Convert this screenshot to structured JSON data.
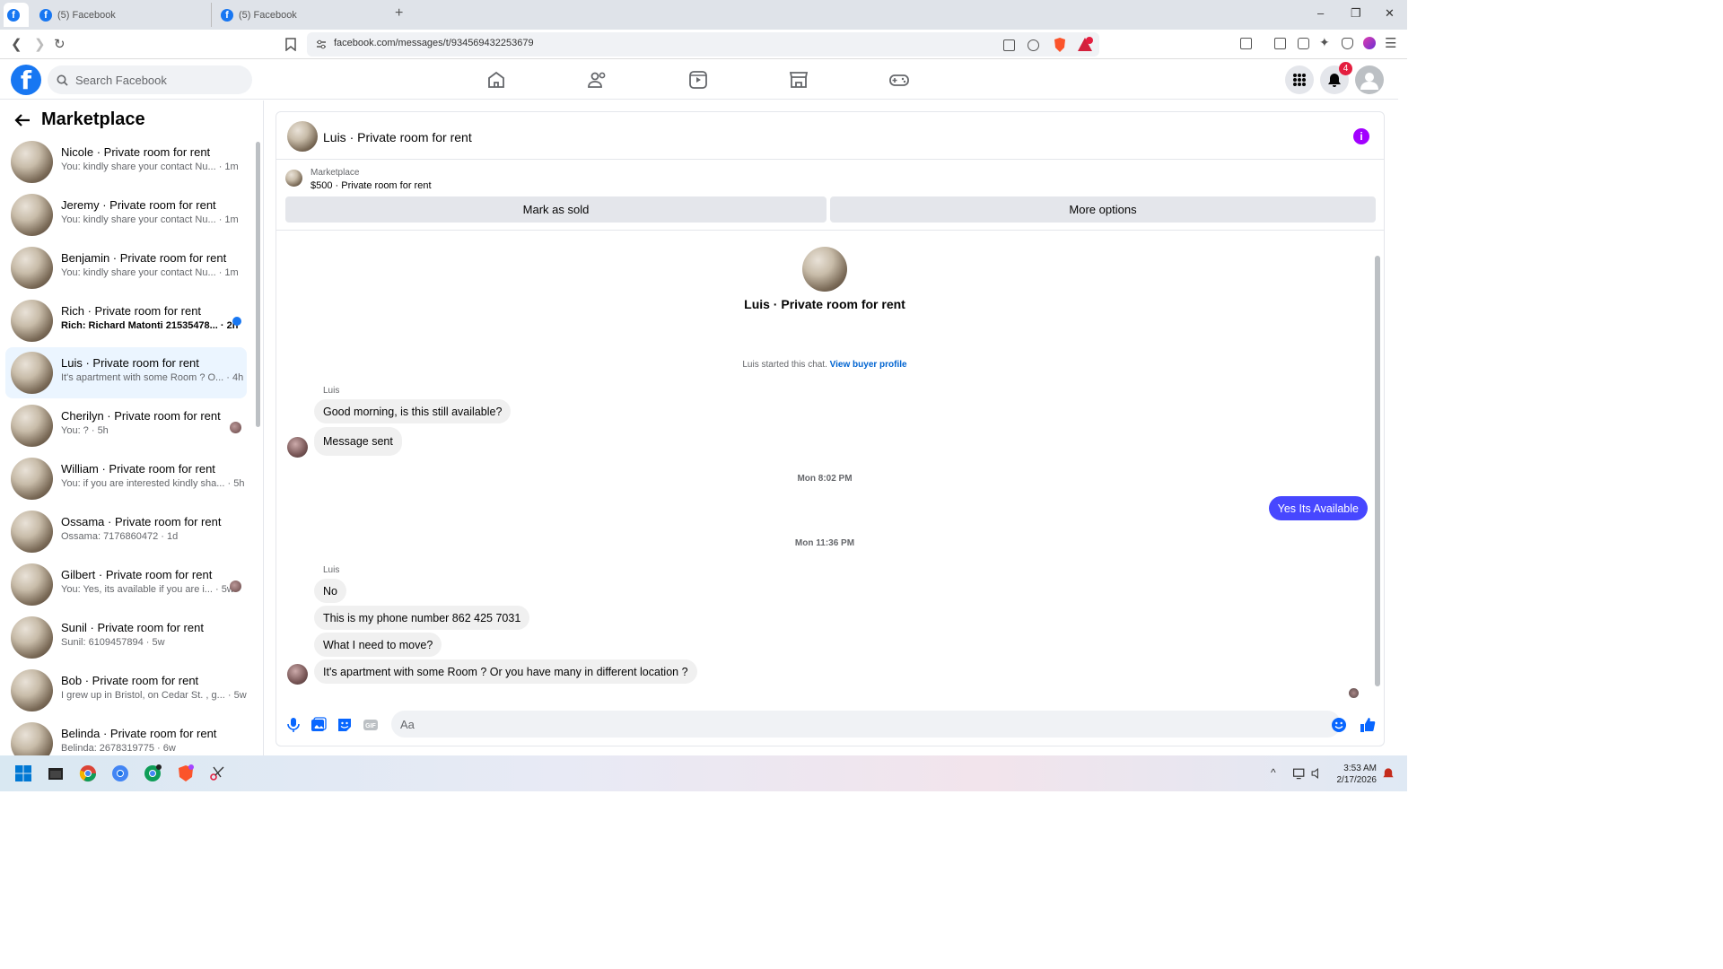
{
  "browser": {
    "tabs": [
      {
        "label": ""
      },
      {
        "label": "(5) Facebook"
      },
      {
        "label": "(5) Facebook"
      }
    ],
    "url": "facebook.com/messages/t/934569432253679",
    "new_tab_symbol": "+",
    "window_controls": {
      "minimize": "–",
      "restore": "❐",
      "close": "✕"
    }
  },
  "header": {
    "search_placeholder": "Search Facebook",
    "notification_count": "4"
  },
  "sidebar": {
    "title": "Marketplace",
    "conversations": [
      {
        "name": "Nicole · Private room for rent",
        "snippet": "You: kindly share your contact Nu... · 1m",
        "unread": false
      },
      {
        "name": "Jeremy · Private room for rent",
        "snippet": "You: kindly share your contact Nu... · 1m",
        "unread": false
      },
      {
        "name": "Benjamin · Private room for rent",
        "snippet": "You: kindly share your contact Nu... · 1m",
        "unread": false
      },
      {
        "name": "Rich · Private room for rent",
        "snippet": "Rich: Richard Matonti 21535478... · 2h",
        "unread": true
      },
      {
        "name": "Luis · Private room for rent",
        "snippet": "It's apartment with some Room ? O... · 4h",
        "unread": false
      },
      {
        "name": "Cherilyn · Private room for rent",
        "snippet": "You: ? · 5h",
        "unread": false
      },
      {
        "name": "William · Private room for rent",
        "snippet": "You: if you are interested kindly sha... · 5h",
        "unread": false
      },
      {
        "name": "Ossama · Private room for rent",
        "snippet": "Ossama: 7176860472 · 1d",
        "unread": false
      },
      {
        "name": "Gilbert · Private room for rent",
        "snippet": "You: Yes, its available if you are i... · 5w",
        "unread": false
      },
      {
        "name": "Sunil · Private room for rent",
        "snippet": "Sunil: 6109457894 · 5w",
        "unread": false
      },
      {
        "name": "Bob · Private room for rent",
        "snippet": "I grew up in Bristol, on Cedar St. , g... · 5w",
        "unread": false
      },
      {
        "name": "Belinda · Private room for rent",
        "snippet": "Belinda: 2678319775 · 6w",
        "unread": false
      }
    ]
  },
  "chat": {
    "title": "Luis · Private room for rent",
    "listing": {
      "label": "Marketplace",
      "price_title": "$500 · Private room for rent",
      "mark_sold": "Mark as sold",
      "more_options": "More options"
    },
    "intro_title": "Luis · Private room for rent",
    "started_text": "Luis started this chat.",
    "view_profile": "View buyer profile",
    "sender1": "Luis",
    "msg1": "Good morning, is this still available?",
    "msg2": "Message sent",
    "time1": "Mon 8:02 PM",
    "out1": "Yes Its Available",
    "time2": "Mon 11:36 PM",
    "sender2": "Luis",
    "msg3": "No",
    "msg4": "This is my phone number 862 425 7031",
    "msg5": "What  I need to move?",
    "msg6": "It's apartment with some Room ? Or you have many in different location ?",
    "input_placeholder": "Aa"
  },
  "taskbar": {
    "time": "3:53 AM",
    "date": "2/17/2026"
  },
  "colors": {
    "brand": "#1877f2",
    "outgoing_bubble": "#4747ff",
    "info": "#a200ff"
  }
}
